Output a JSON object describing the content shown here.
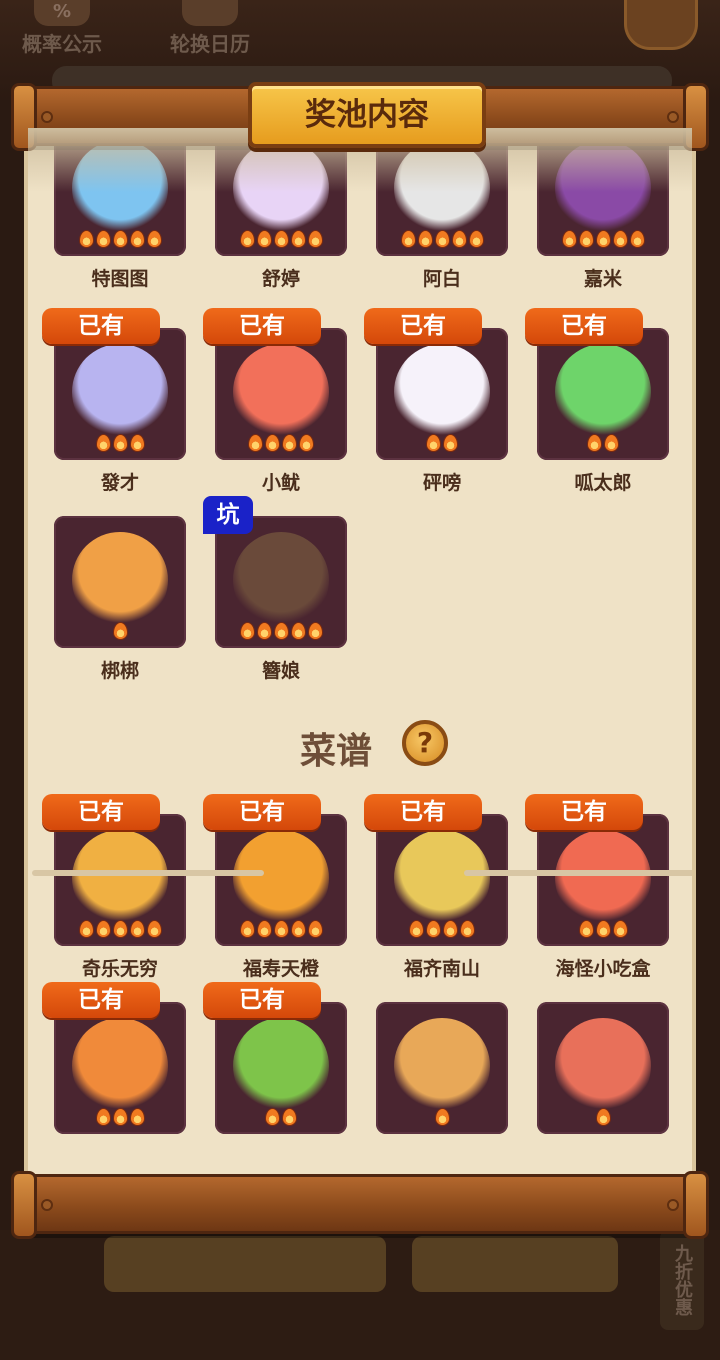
{
  "background": {
    "top_buttons": [
      {
        "label": "概率公示",
        "icon": "percent-icon",
        "icon_glyph": "%"
      },
      {
        "label": "轮换日历",
        "icon": "calendar-icon",
        "icon_glyph": ""
      }
    ],
    "bottom_side_label": "九折优惠"
  },
  "modal": {
    "title": "奖池内容"
  },
  "characters": [
    {
      "name": "特图图",
      "flames": 5,
      "owned": false,
      "pit": false,
      "color": "#7ec4f0"
    },
    {
      "name": "舒婷",
      "flames": 5,
      "owned": false,
      "pit": false,
      "color": "#e8d4f6"
    },
    {
      "name": "阿白",
      "flames": 5,
      "owned": false,
      "pit": false,
      "color": "#e6e6e6"
    },
    {
      "name": "嘉米",
      "flames": 5,
      "owned": false,
      "pit": false,
      "color": "#8a4aa6"
    },
    {
      "name": "發才",
      "flames": 3,
      "owned": true,
      "pit": false,
      "color": "#b8b4f0"
    },
    {
      "name": "小鱿",
      "flames": 4,
      "owned": true,
      "pit": false,
      "color": "#f2705a"
    },
    {
      "name": "砰嗙",
      "flames": 2,
      "owned": true,
      "pit": false,
      "color": "#f6f2fa"
    },
    {
      "name": "呱太郎",
      "flames": 2,
      "owned": true,
      "pit": false,
      "color": "#6ed46a"
    },
    {
      "name": "梆梆",
      "flames": 1,
      "owned": false,
      "pit": false,
      "color": "#f0a046"
    },
    {
      "name": "簪娘",
      "flames": 5,
      "owned": false,
      "pit": true,
      "color": "#6a4a3a"
    }
  ],
  "owned_label": "已有",
  "pit_label": "坑",
  "recipes_section": {
    "title": "菜谱",
    "help_glyph": "?"
  },
  "recipes": [
    {
      "name": "奇乐无穷",
      "flames": 5,
      "owned": true,
      "color": "#f0b042"
    },
    {
      "name": "福寿天橙",
      "flames": 5,
      "owned": true,
      "color": "#f2a030"
    },
    {
      "name": "福齐南山",
      "flames": 4,
      "owned": true,
      "color": "#e8c85a"
    },
    {
      "name": "海怪小吃盒",
      "flames": 3,
      "owned": true,
      "color": "#f06a52"
    },
    {
      "name": "",
      "flames": 3,
      "owned": true,
      "color": "#f08a3a"
    },
    {
      "name": "",
      "flames": 2,
      "owned": true,
      "color": "#7ec44a"
    },
    {
      "name": "",
      "flames": 1,
      "owned": false,
      "color": "#e8a858"
    },
    {
      "name": "",
      "flames": 1,
      "owned": false,
      "color": "#e8705a"
    }
  ]
}
